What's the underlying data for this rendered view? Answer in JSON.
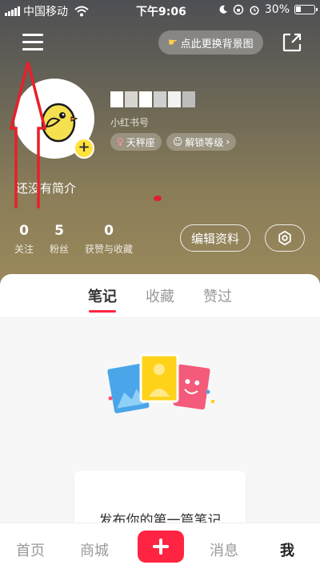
{
  "status_bar": {
    "carrier": "中国移动",
    "time": "下午9:06",
    "battery": "30%"
  },
  "header": {
    "change_bg_label": "点此更换背景图"
  },
  "profile": {
    "id_label": "小红书号",
    "tags": [
      {
        "label": "天秤座",
        "icon": "libra-icon"
      },
      {
        "label": "解锁等级",
        "icon": "level-icon"
      }
    ],
    "bio": "还没有简介",
    "stats": [
      {
        "value": "0",
        "label": "关注"
      },
      {
        "value": "5",
        "label": "粉丝"
      },
      {
        "value": "0",
        "label": "获赞与收藏"
      }
    ],
    "edit_label": "编辑资料"
  },
  "tabs": [
    {
      "label": "笔记",
      "active": true
    },
    {
      "label": "收藏",
      "active": false
    },
    {
      "label": "赞过",
      "active": false
    }
  ],
  "empty_state": {
    "text": "发布你的第一篇笔记"
  },
  "bottom_nav": {
    "home": "首页",
    "mall": "商城",
    "messages": "消息",
    "me": "我"
  },
  "colors": {
    "accent": "#ff2442",
    "annotation": "#e8202a"
  }
}
